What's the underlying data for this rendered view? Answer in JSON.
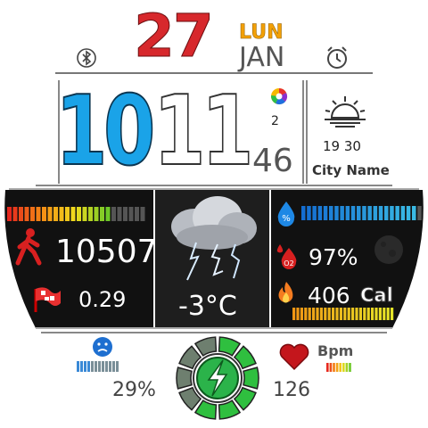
{
  "date": {
    "day": "27",
    "weekday": "LUN",
    "month": "JAN"
  },
  "time": {
    "hours": "10",
    "minutes": "11",
    "seconds": "46",
    "small_value": "2"
  },
  "sun": {
    "times": "19 30"
  },
  "location": {
    "city": "City Name"
  },
  "activity": {
    "steps": "10507",
    "distance": "0.29"
  },
  "weather": {
    "temperature": "-3°C",
    "humidity": "97%"
  },
  "calories": {
    "value": "406",
    "label": "Cal"
  },
  "battery": {
    "percent": "29%",
    "level": 0.29
  },
  "heart": {
    "value": "126",
    "label": "Bpm"
  },
  "icons": [
    "bluetooth-icon",
    "alarm-icon",
    "color-wheel-icon",
    "sunset-icon",
    "walking-person-icon",
    "finish-flag-icon",
    "thunderstorm-icon",
    "humidity-drop-icon",
    "oxygen-drop-icon",
    "flame-icon",
    "moon-icon",
    "battery-face-icon",
    "charging-icon",
    "heart-icon"
  ],
  "colors": {
    "hours": "#1aa3e8",
    "day": "#d7282c",
    "weekday": "#f2a007",
    "charging_ring": "#22b14c"
  }
}
